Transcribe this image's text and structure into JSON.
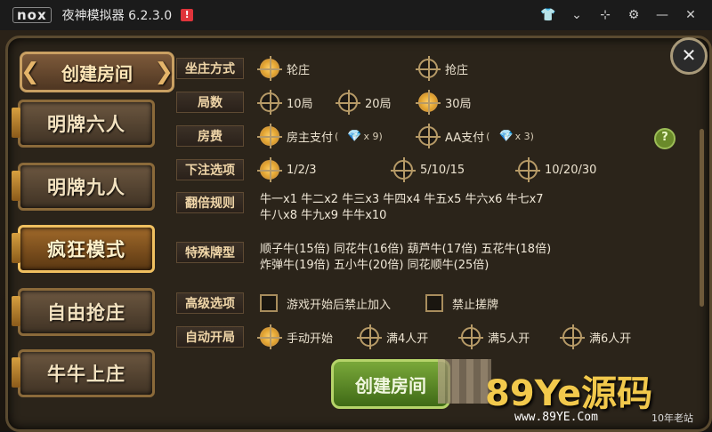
{
  "titlebar": {
    "logo": "nox",
    "title": "夜神模拟器 6.2.3.0",
    "badge": "!",
    "icons": [
      "shirt-icon",
      "chevron-down-icon",
      "pin-icon",
      "gear-icon",
      "minimize-icon",
      "close-icon"
    ]
  },
  "sidebar": {
    "header": "创建房间",
    "items": [
      {
        "label": "明牌六人",
        "active": false
      },
      {
        "label": "明牌九人",
        "active": false
      },
      {
        "label": "疯狂模式",
        "active": true
      },
      {
        "label": "自由抢庄",
        "active": false
      },
      {
        "label": "牛牛上庄",
        "active": false
      }
    ]
  },
  "form": {
    "zhuang": {
      "label": "坐庄方式",
      "options": [
        "轮庄",
        "抢庄"
      ],
      "selected": "轮庄"
    },
    "rounds": {
      "label": "局数",
      "options": [
        "10局",
        "20局",
        "30局"
      ],
      "selected": "30局"
    },
    "fee": {
      "label": "房费",
      "options": [
        "房主支付",
        "AA支付"
      ],
      "selected": "房主支付",
      "host_cost": "x 9)",
      "aa_cost": "x 3)",
      "paren": "("
    },
    "bet": {
      "label": "下注选项",
      "options": [
        "1/2/3",
        "5/10/15",
        "10/20/30"
      ],
      "selected": "1/2/3"
    },
    "double": {
      "label": "翻倍规则",
      "line1": "牛一x1 牛二x2 牛三x3 牛四x4 牛五x5 牛六x6 牛七x7",
      "line2": "牛八x8 牛九x9 牛牛x10"
    },
    "special": {
      "label": "特殊牌型",
      "line1": "顺子牛(15倍) 同花牛(16倍) 葫芦牛(17倍) 五花牛(18倍)",
      "line2": "炸弹牛(19倍) 五小牛(20倍) 同花顺牛(25倍)"
    },
    "advanced": {
      "label": "高级选项",
      "options": [
        "游戏开始后禁止加入",
        "禁止搓牌"
      ]
    },
    "autostart": {
      "label": "自动开局",
      "options": [
        "手动开始",
        "满4人开",
        "满5人开",
        "满6人开"
      ],
      "selected": "手动开始"
    }
  },
  "help": "?",
  "close": "✕",
  "create_button": "创建房间",
  "watermark": {
    "big": "89Ye源码",
    "url": "www.89YE.Com",
    "tag": "10年老站"
  }
}
